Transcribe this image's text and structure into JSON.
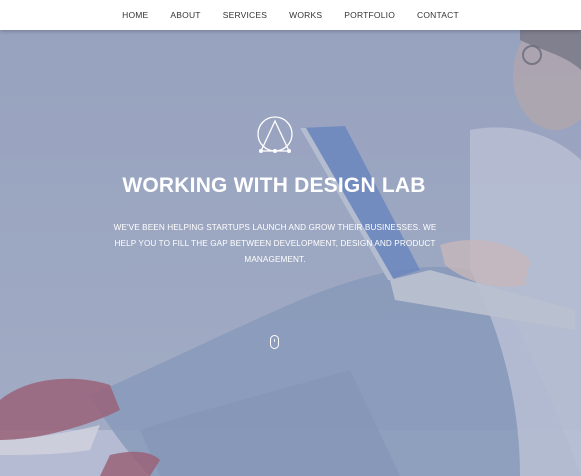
{
  "nav": {
    "items": [
      {
        "label": "HOME"
      },
      {
        "label": "ABOUT"
      },
      {
        "label": "SERVICES"
      },
      {
        "label": "WORKS"
      },
      {
        "label": "PORTFOLIO"
      },
      {
        "label": "CONTACT"
      }
    ]
  },
  "hero": {
    "title": "WORKING WITH DESIGN LAB",
    "subtitle": "WE'VE BEEN HELPING STARTUPS LAUNCH AND GROW THEIR BUSINESSES. WE HELP YOU TO FILL THE GAP BETWEEN DEVELOPMENT, DESIGN AND PRODUCT MANAGEMENT.",
    "logo_icon": "triangle-circle-logo-icon",
    "scroll_icon": "mouse-scroll-icon"
  },
  "colors": {
    "nav_bg": "#ffffff",
    "nav_text": "#333333",
    "hero_overlay": "#9aa6c0",
    "hero_text": "#ffffff"
  }
}
